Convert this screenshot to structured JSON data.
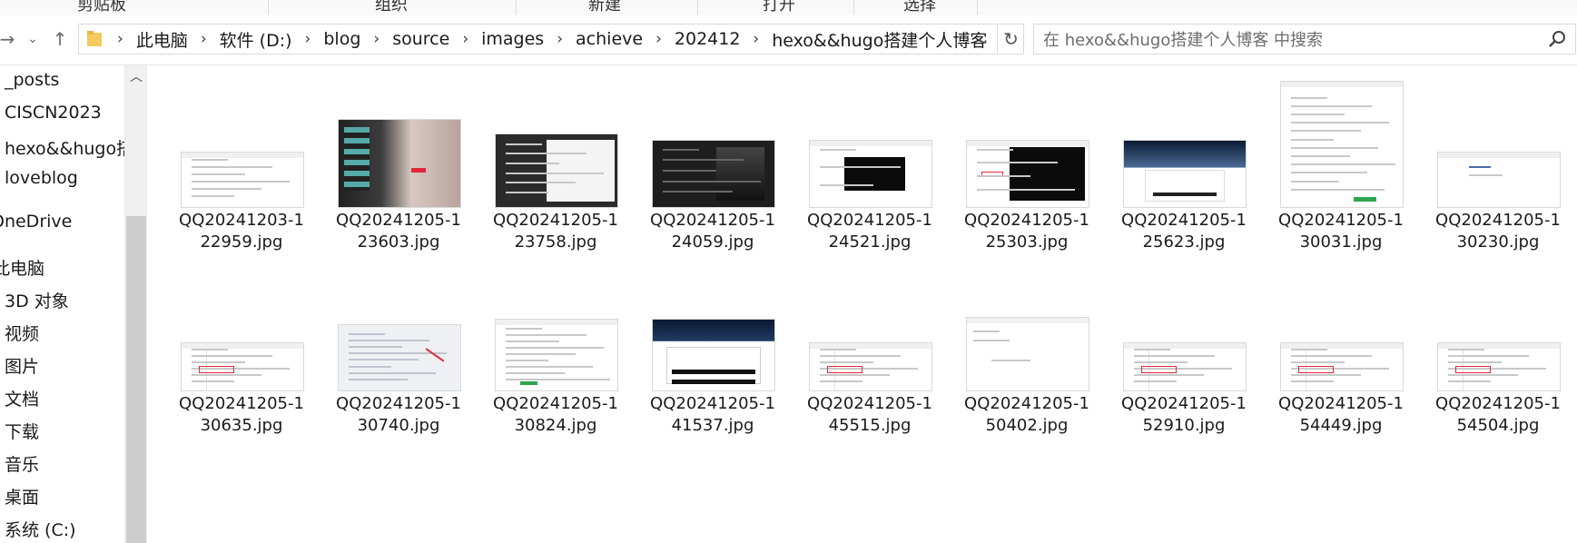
{
  "ribbon": {
    "groups": [
      "剪贴板",
      "组织",
      "新建",
      "打开",
      "选择"
    ]
  },
  "nav": {
    "back_icon": "arrow-left-icon",
    "recent_icon": "chevron-down-icon",
    "up_icon": "arrow-up-icon",
    "breadcrumbs": [
      "此电脑",
      "软件 (D:)",
      "blog",
      "source",
      "images",
      "achieve",
      "202412",
      "hexo&&hugo搭建个人博客"
    ],
    "refresh_icon": "refresh-icon",
    "search_placeholder": "在 hexo&&hugo搭建个人博客 中搜索"
  },
  "sidebar": {
    "items": [
      "_posts",
      "CISCN2023",
      "hexo&&hugo搭",
      "loveblog",
      "OneDrive",
      "此电脑",
      "3D 对象",
      "视频",
      "图片",
      "文档",
      "下载",
      "音乐",
      "桌面",
      "系统 (C:)"
    ]
  },
  "files": [
    {
      "name": "QQ20241203-1\n22959.jpg",
      "kind": "doc"
    },
    {
      "name": "QQ20241205-1\n23603.jpg",
      "kind": "anime"
    },
    {
      "name": "QQ20241205-1\n23758.jpg",
      "kind": "desk"
    },
    {
      "name": "QQ20241205-1\n24059.jpg",
      "kind": "darkterm"
    },
    {
      "name": "QQ20241205-1\n24521.jpg",
      "kind": "blackbox"
    },
    {
      "name": "QQ20241205-1\n25303.jpg",
      "kind": "terminal"
    },
    {
      "name": "QQ20241205-1\n25623.jpg",
      "kind": "space"
    },
    {
      "name": "QQ20241205-1\n30031.jpg",
      "kind": "tall"
    },
    {
      "name": "QQ20241205-1\n30230.jpg",
      "kind": "plain"
    },
    {
      "name": "QQ20241205-1\n30635.jpg",
      "kind": "explorer"
    },
    {
      "name": "QQ20241205-1\n30740.jpg",
      "kind": "settings"
    },
    {
      "name": "QQ20241205-1\n30824.jpg",
      "kind": "form"
    },
    {
      "name": "QQ20241205-1\n41537.jpg",
      "kind": "space2"
    },
    {
      "name": "QQ20241205-1\n45515.jpg",
      "kind": "explorer"
    },
    {
      "name": "QQ20241205-1\n50402.jpg",
      "kind": "editor"
    },
    {
      "name": "QQ20241205-1\n52910.jpg",
      "kind": "explorer"
    },
    {
      "name": "QQ20241205-1\n54449.jpg",
      "kind": "explorer"
    },
    {
      "name": "QQ20241205-1\n54504.jpg",
      "kind": "explorer"
    }
  ],
  "colors": {
    "selection_red": "#e0283a",
    "folder_yellow": "#f4c95d"
  }
}
